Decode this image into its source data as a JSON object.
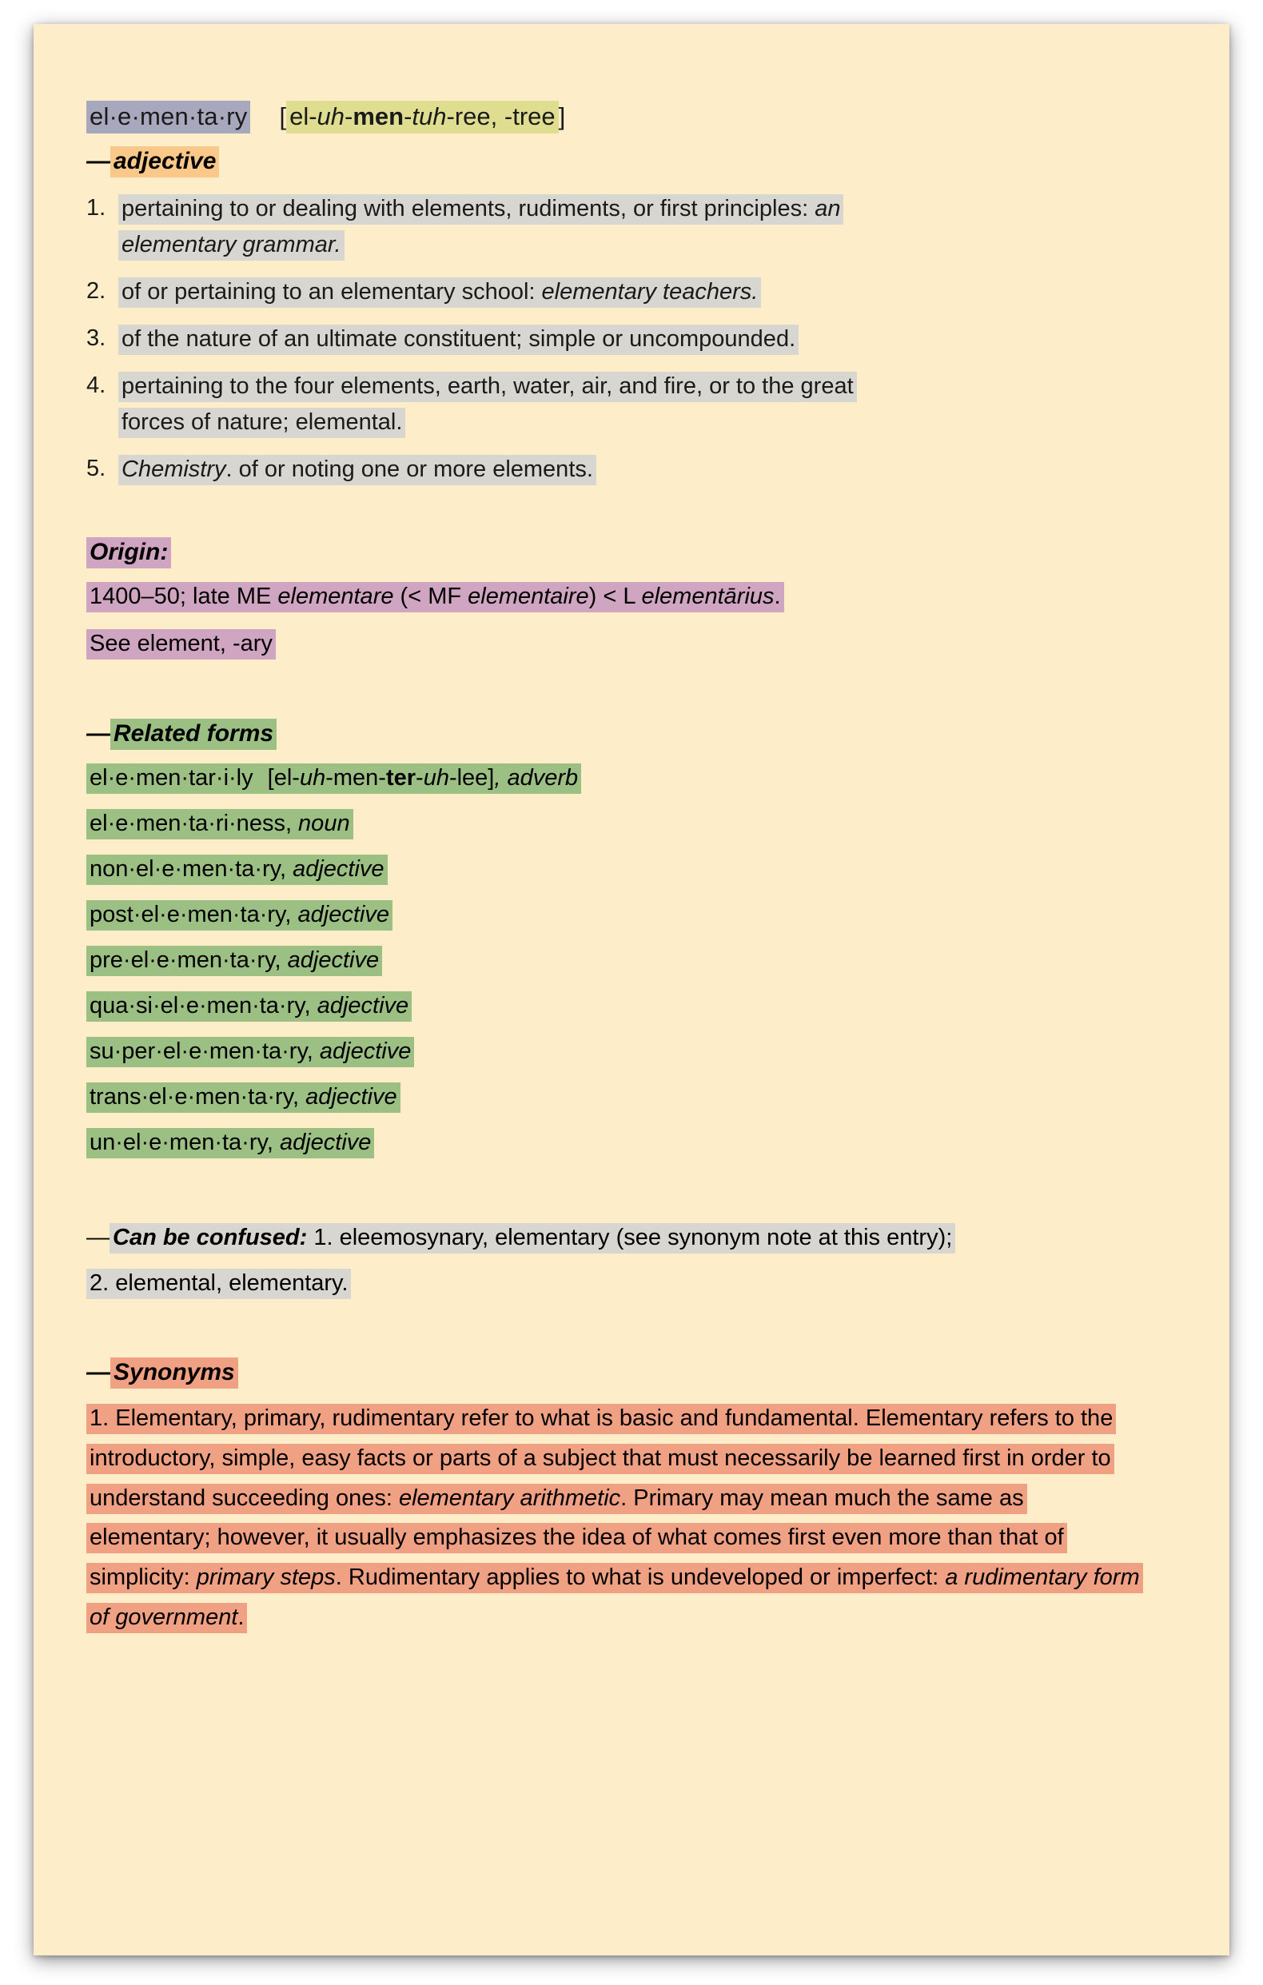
{
  "entry": {
    "headword": "el·e·men·ta·ry",
    "pronunciation": {
      "open_bracket": "[",
      "p1": "el-",
      "p2_italic": "uh",
      "p3": "-",
      "p4_bold": "men",
      "p5": "-",
      "p6_italic": "tuh",
      "p7": "-ree, -tree",
      "close_bracket": "]"
    },
    "part_of_speech": {
      "dash": "—",
      "label": "adjective"
    },
    "definitions": [
      {
        "num": "1.",
        "line1": "pertaining to or dealing with elements, rudiments, or first principles: ",
        "line1_italic": "an",
        "line2_italic": "elementary grammar."
      },
      {
        "num": "2.",
        "line1": "of or pertaining to an elementary school: ",
        "line1_italic": "elementary teachers."
      },
      {
        "num": "3.",
        "line1": "of the nature of an ultimate constituent; simple or uncompounded."
      },
      {
        "num": "4.",
        "line1": "pertaining to the four elements, earth, water, air, and fire, or to the great",
        "line2": "forces of nature; elemental."
      },
      {
        "num": "5.",
        "line1_italic": "Chemistry",
        "line1": ". of or noting one or more elements."
      }
    ],
    "origin": {
      "heading": "Origin:",
      "line1_a": "1400–50; late ME ",
      "line1_b_italic": "elementare",
      "line1_c": " (< MF ",
      "line1_d_italic": "elementaire",
      "line1_e": ") < L ",
      "line1_f_italic": "elementārius",
      "line1_g": ".",
      "line2": "See element, -ary"
    },
    "related_forms": {
      "heading_dash": "—",
      "heading": "Related forms",
      "items": [
        {
          "word": "el·e·men·tar·i·ly",
          "pron_open": "[el-",
          "pron_i1": "uh",
          "pron_mid1": "-men-",
          "pron_b": "ter",
          "pron_mid2": "-",
          "pron_i2": "uh",
          "pron_end": "-lee]",
          "pos": ", adverb"
        },
        {
          "word": "el·e·men·ta·ri·ness,",
          "pos": " noun"
        },
        {
          "word": "non·el·e·men·ta·ry,",
          "pos": " adjective"
        },
        {
          "word": "post·el·e·men·ta·ry,",
          "pos": " adjective"
        },
        {
          "word": "pre·el·e·men·ta·ry,",
          "pos": " adjective"
        },
        {
          "word": "qua·si·el·e·men·ta·ry,",
          "pos": " adjective"
        },
        {
          "word": "su·per·el·e·men·ta·ry,",
          "pos": " adjective"
        },
        {
          "word": "trans·el·e·men·ta·ry,",
          "pos": " adjective"
        },
        {
          "word": "un·el·e·men·ta·ry,",
          "pos": " adjective"
        }
      ]
    },
    "can_be_confused": {
      "dash": "—",
      "heading": "Can be confused:",
      "line1": "  1. eleemosynary, elementary (see synonym note at this entry);",
      "line2": "2. elemental, elementary."
    },
    "synonyms": {
      "heading_dash": "—",
      "heading": "Synonyms",
      "para_a": "1. Elementary, primary, rudimentary refer to what is basic and fundamental. Elementary refers to the introductory, simple, easy facts or parts of a subject that must necessarily be learned first in order to understand succeeding ones: ",
      "para_b_italic": "elementary arithmetic",
      "para_c": ". Primary may mean much the same as elementary; however, it usually emphasizes the idea of what comes first even more than that of simplicity: ",
      "para_d_italic": "primary steps",
      "para_e": ". Rudimentary applies to what is undeveloped or imperfect: ",
      "para_f_italic": "a rudimentary form of government",
      "para_g": "."
    }
  },
  "colors": {
    "page_background": "#fdeec9",
    "headword_highlight": "#a7a8bd",
    "pronunciation_highlight": "#dfdd8f",
    "pos_highlight": "#fac98a",
    "definition_highlight": "#d8d6d0",
    "origin_highlight": "#cfa5c1",
    "related_forms_highlight": "#9cbf84",
    "can_be_confused_highlight": "#d8d6d0",
    "synonyms_highlight": "#f0a183",
    "text": "#1a1a1a"
  }
}
